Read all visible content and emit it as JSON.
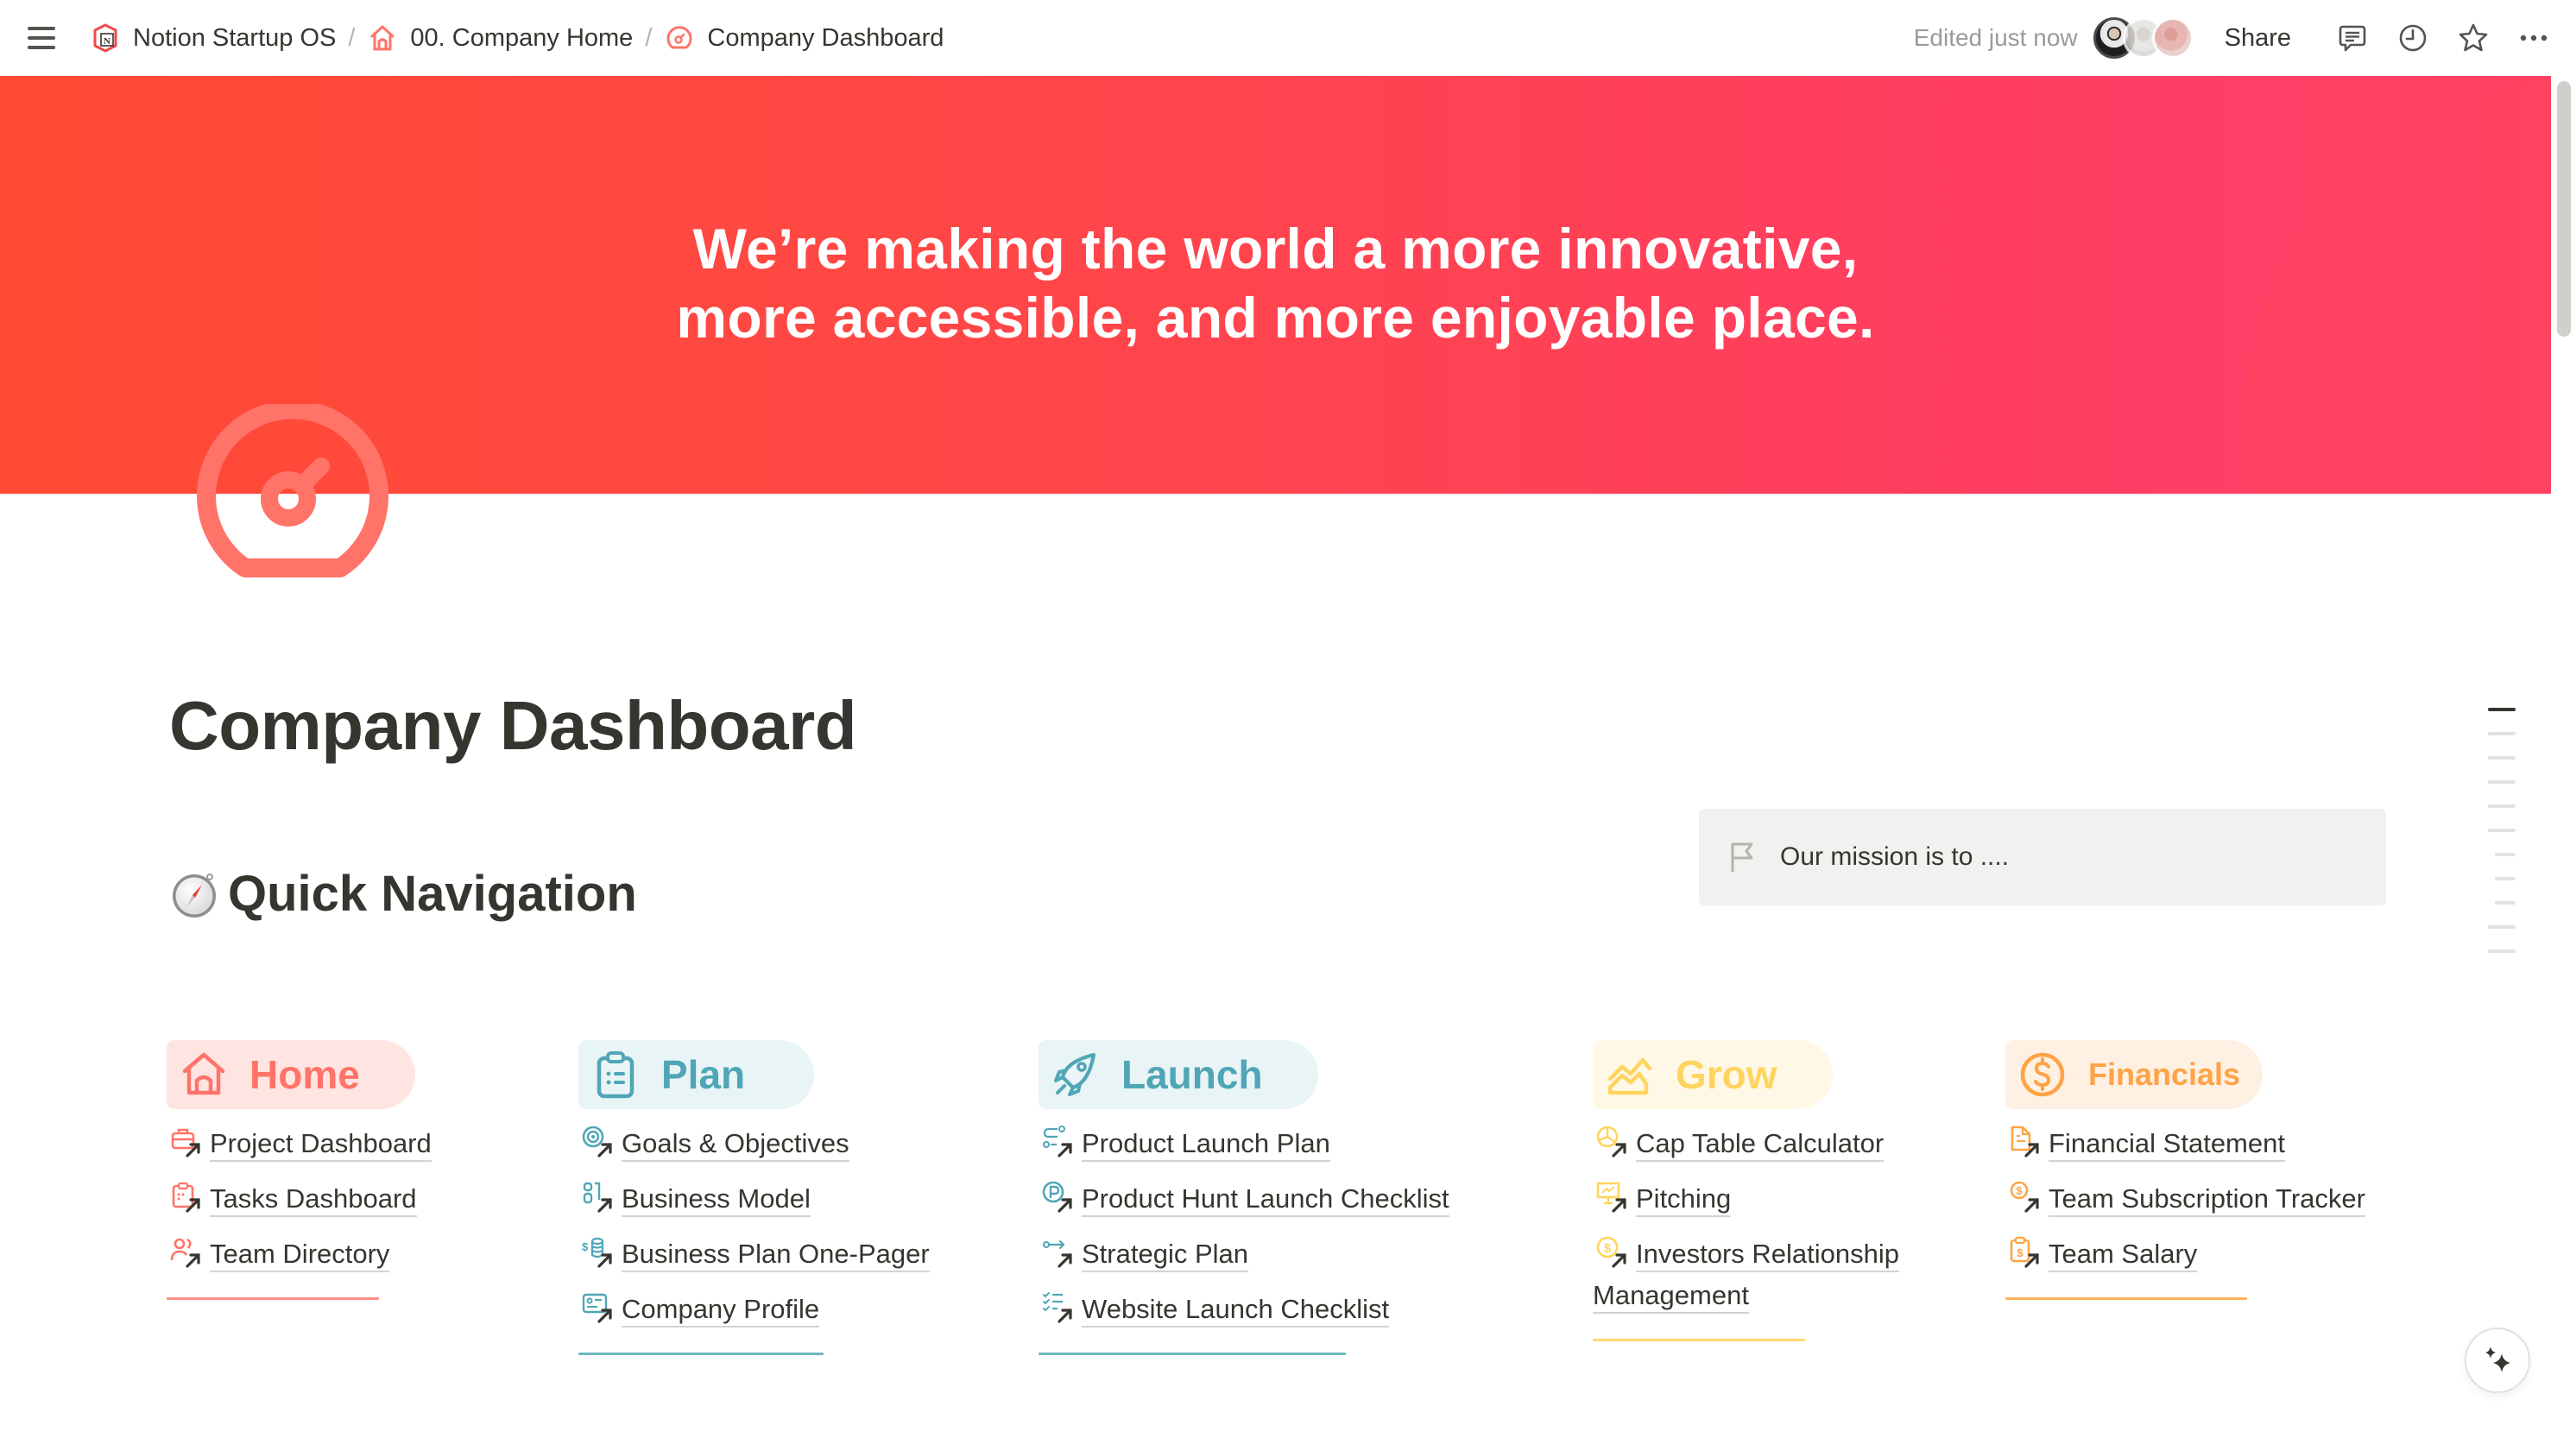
{
  "topbar": {
    "breadcrumbs": [
      {
        "label": "Notion Startup OS",
        "icon": "notion-box-icon"
      },
      {
        "label": "00. Company Home",
        "icon": "home-icon"
      },
      {
        "label": "Company Dashboard",
        "icon": "gauge-icon"
      }
    ],
    "separator": "/",
    "edited": "Edited just now",
    "share_label": "Share",
    "icons": [
      "comments-icon",
      "history-clock-icon",
      "favorite-star-icon",
      "more-options-icon"
    ]
  },
  "cover": {
    "quote_line1": "We’re making the world a more innovative,",
    "quote_line2": "more accessible, and more enjoyable place."
  },
  "page": {
    "title": "Company Dashboard",
    "icon": "gauge-icon",
    "section_heading": "Quick Navigation",
    "section_emoji": "compass-icon"
  },
  "callout": {
    "icon": "flag-icon",
    "text": "Our mission is to ...."
  },
  "toc": {
    "count": 11,
    "active_index": 0,
    "indented": [
      6,
      7,
      8
    ]
  },
  "colors": {
    "home": "#ff7369",
    "plan": "#4fa6b6",
    "launch": "#4fa6b6",
    "grow": "#ffd45e",
    "financials": "#ffa344"
  },
  "columns": [
    {
      "key": "home",
      "label": "Home",
      "icon": "home-icon",
      "links": [
        {
          "label": "Project Dashboard",
          "icon": "briefcase-link-icon"
        },
        {
          "label": "Tasks Dashboard",
          "icon": "clipboard-link-icon"
        },
        {
          "label": "Team Directory",
          "icon": "people-link-icon"
        }
      ]
    },
    {
      "key": "plan",
      "label": "Plan",
      "icon": "clipboard-icon",
      "links": [
        {
          "label": "Goals & Objectives",
          "icon": "target-link-icon"
        },
        {
          "label": "Business Model",
          "icon": "blocks-link-icon"
        },
        {
          "label": "Business Plan One-Pager",
          "icon": "coins-link-icon"
        },
        {
          "label": "Company Profile",
          "icon": "id-card-link-icon"
        }
      ]
    },
    {
      "key": "launch",
      "label": "Launch",
      "icon": "rocket-icon",
      "links": [
        {
          "label": "Product Launch Plan",
          "icon": "route-link-icon"
        },
        {
          "label": "Product Hunt Launch Checklist",
          "icon": "product-hunt-link-icon"
        },
        {
          "label": "Strategic Plan",
          "icon": "arrow-path-link-icon"
        },
        {
          "label": "Website Launch Checklist",
          "icon": "checklist-link-icon"
        }
      ]
    },
    {
      "key": "grow",
      "label": "Grow",
      "icon": "chart-area-icon",
      "links": [
        {
          "label": "Cap Table Calculator",
          "icon": "pie-chart-link-icon"
        },
        {
          "label": "Pitching",
          "icon": "presentation-link-icon"
        },
        {
          "label": "Investors Relationship Management",
          "icon": "dollar-coin-link-icon"
        }
      ]
    },
    {
      "key": "financials",
      "label": "Financials",
      "icon": "dollar-circle-icon",
      "links": [
        {
          "label": "Financial Statement",
          "icon": "document-link-icon"
        },
        {
          "label": "Team Subscription Tracker",
          "icon": "dollar-coin-link-icon"
        },
        {
          "label": "Team Salary",
          "icon": "clipboard-dollar-link-icon"
        }
      ]
    }
  ],
  "fab": {
    "icon": "ai-sparkle-icon"
  }
}
